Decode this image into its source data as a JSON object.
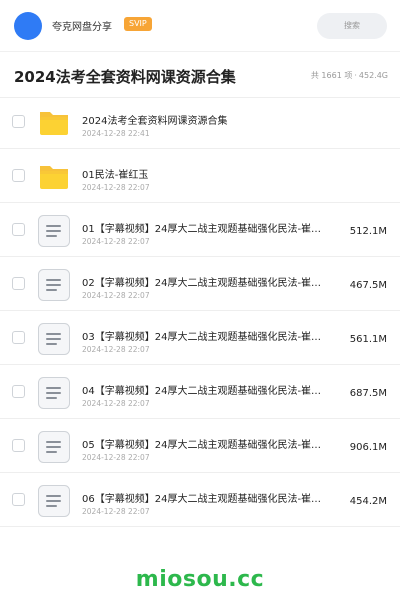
{
  "header": {
    "brand": "夸克网盘分享",
    "badge": "SVIP",
    "search_label": "搜索",
    "colors": {
      "logo": "#2f7bf5",
      "badge": "#f7a536"
    }
  },
  "title_bar": {
    "title": "2024法考全套资料网课资源合集",
    "count": "共 1661 项",
    "separator": "·",
    "total_size": "452.4G"
  },
  "items": [
    {
      "type": "folder",
      "icon": "folder-icon",
      "name": "2024法考全套资料网课资源合集",
      "date": "2024-12-28 22:41",
      "size": ""
    },
    {
      "type": "folder",
      "icon": "folder-icon",
      "name": "01民法-崔红玉",
      "date": "2024-12-28 22:07",
      "size": ""
    },
    {
      "type": "file",
      "icon": "document-icon",
      "name": "01【字幕视频】24厚大二战主观题基础强化民法-崔…",
      "date": "2024-12-28 22:07",
      "size": "512.1M"
    },
    {
      "type": "file",
      "icon": "document-icon",
      "name": "02【字幕视频】24厚大二战主观题基础强化民法-崔…",
      "date": "2024-12-28 22:07",
      "size": "467.5M"
    },
    {
      "type": "file",
      "icon": "document-icon",
      "name": "03【字幕视频】24厚大二战主观题基础强化民法-崔…",
      "date": "2024-12-28 22:07",
      "size": "561.1M"
    },
    {
      "type": "file",
      "icon": "document-icon",
      "name": "04【字幕视频】24厚大二战主观题基础强化民法-崔…",
      "date": "2024-12-28 22:07",
      "size": "687.5M"
    },
    {
      "type": "file",
      "icon": "document-icon",
      "name": "05【字幕视频】24厚大二战主观题基础强化民法-崔…",
      "date": "2024-12-28 22:07",
      "size": "906.1M"
    },
    {
      "type": "file",
      "icon": "document-icon",
      "name": "06【字幕视频】24厚大二战主观题基础强化民法-崔…",
      "date": "2024-12-28 22:07",
      "size": "454.2M"
    }
  ],
  "footer": {
    "watermark": "miosou.cc",
    "watermark_color": "#2db84c"
  }
}
